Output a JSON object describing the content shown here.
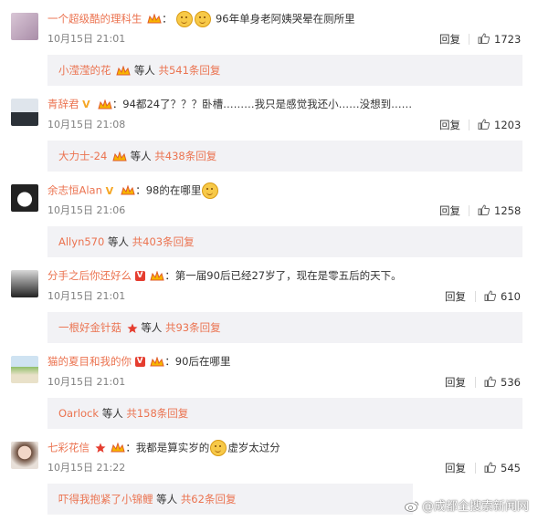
{
  "comments": [
    {
      "user": "一个超级酷的理科生",
      "text": "96年单身老阿姨哭晕在厕所里",
      "time": "10月15日 21:01",
      "reply_label": "回复",
      "likes": "1723",
      "replies_user": "小滢滢的花",
      "replies_mid": "等人",
      "replies_count": "共541条回复",
      "emojis": [
        "smile-emoji",
        "smile-emoji"
      ]
    },
    {
      "user": "青辞君",
      "text": "：94都24了？？？卧槽………我只是感觉我还小……没想到……",
      "time": "10月15日 21:08",
      "reply_label": "回复",
      "likes": "1203",
      "replies_user": "大力士-24",
      "replies_mid": "等人",
      "replies_count": "共438条回复"
    },
    {
      "user": "余志恒Alan",
      "text": "：98的在哪里",
      "time": "10月15日 21:06",
      "reply_label": "回复",
      "likes": "1258",
      "replies_user": "Allyn570",
      "replies_mid": "等人",
      "replies_count": "共403条回复"
    },
    {
      "user": "分手之后你还好么",
      "text": "：第一届90后已经27岁了，现在是零五后的天下。",
      "time": "10月15日 21:01",
      "reply_label": "回复",
      "likes": "610",
      "replies_user": "一根好金针菇",
      "replies_mid": "等人",
      "replies_count": "共93条回复"
    },
    {
      "user": "猫的夏目和我的你",
      "text": "：90后在哪里",
      "time": "10月15日 21:01",
      "reply_label": "回复",
      "likes": "536",
      "replies_user": "Oarlock",
      "replies_mid": "等人",
      "replies_count": "共158条回复"
    },
    {
      "user": "七彩花信",
      "text_a": "：我都是算实岁的",
      "text_b": "虚岁太过分",
      "time": "10月15日 21:22",
      "reply_label": "回复",
      "likes": "545",
      "replies_user": "吓得我抱紧了小锦鲤",
      "replies_mid": "等人",
      "replies_count": "共62条回复"
    }
  ],
  "watermark": "@成都全搜索新闻网",
  "colors": {
    "accent": "#eb7350",
    "reply_bg": "#f2f2f5",
    "time": "#808080"
  }
}
